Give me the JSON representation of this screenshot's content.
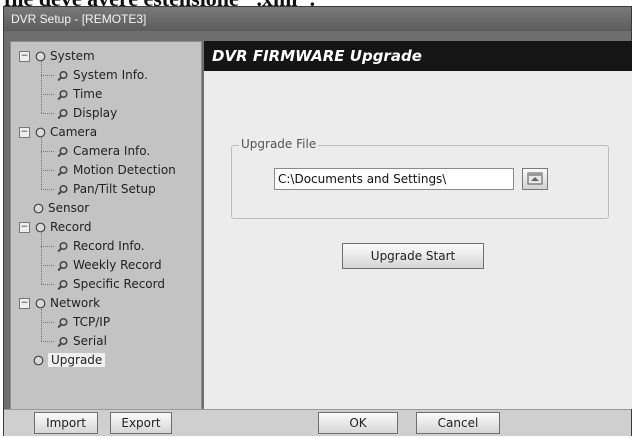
{
  "caption": "file deve avere estensione \".xml\".",
  "window": {
    "title": "DVR Setup - [REMOTE3]"
  },
  "tree": [
    {
      "label": "System",
      "kind": "group",
      "expander": "−"
    },
    {
      "label": "System Info.",
      "kind": "leaf"
    },
    {
      "label": "Time",
      "kind": "leaf"
    },
    {
      "label": "Display",
      "kind": "leaf"
    },
    {
      "label": "Camera",
      "kind": "group",
      "expander": "−"
    },
    {
      "label": "Camera Info.",
      "kind": "leaf"
    },
    {
      "label": "Motion Detection",
      "kind": "leaf"
    },
    {
      "label": "Pan/Tilt Setup",
      "kind": "leaf"
    },
    {
      "label": "Sensor",
      "kind": "group",
      "expander": ""
    },
    {
      "label": "Record",
      "kind": "group",
      "expander": "−"
    },
    {
      "label": "Record Info.",
      "kind": "leaf"
    },
    {
      "label": "Weekly Record",
      "kind": "leaf"
    },
    {
      "label": "Specific Record",
      "kind": "leaf"
    },
    {
      "label": "Network",
      "kind": "group",
      "expander": "−"
    },
    {
      "label": "TCP/IP",
      "kind": "leaf"
    },
    {
      "label": "Serial",
      "kind": "leaf"
    },
    {
      "label": "Upgrade",
      "kind": "group",
      "expander": "",
      "selected": true
    }
  ],
  "content": {
    "header": "DVR FIRMWARE Upgrade",
    "upgrade_file_label": "Upgrade File",
    "file_path": "C:\\Documents and Settings\\",
    "browse_icon": "folder-browse-icon",
    "upgrade_start_label": "Upgrade Start"
  },
  "bottom": {
    "import_label": "Import",
    "export_label": "Export",
    "ok_label": "OK",
    "cancel_label": "Cancel"
  }
}
